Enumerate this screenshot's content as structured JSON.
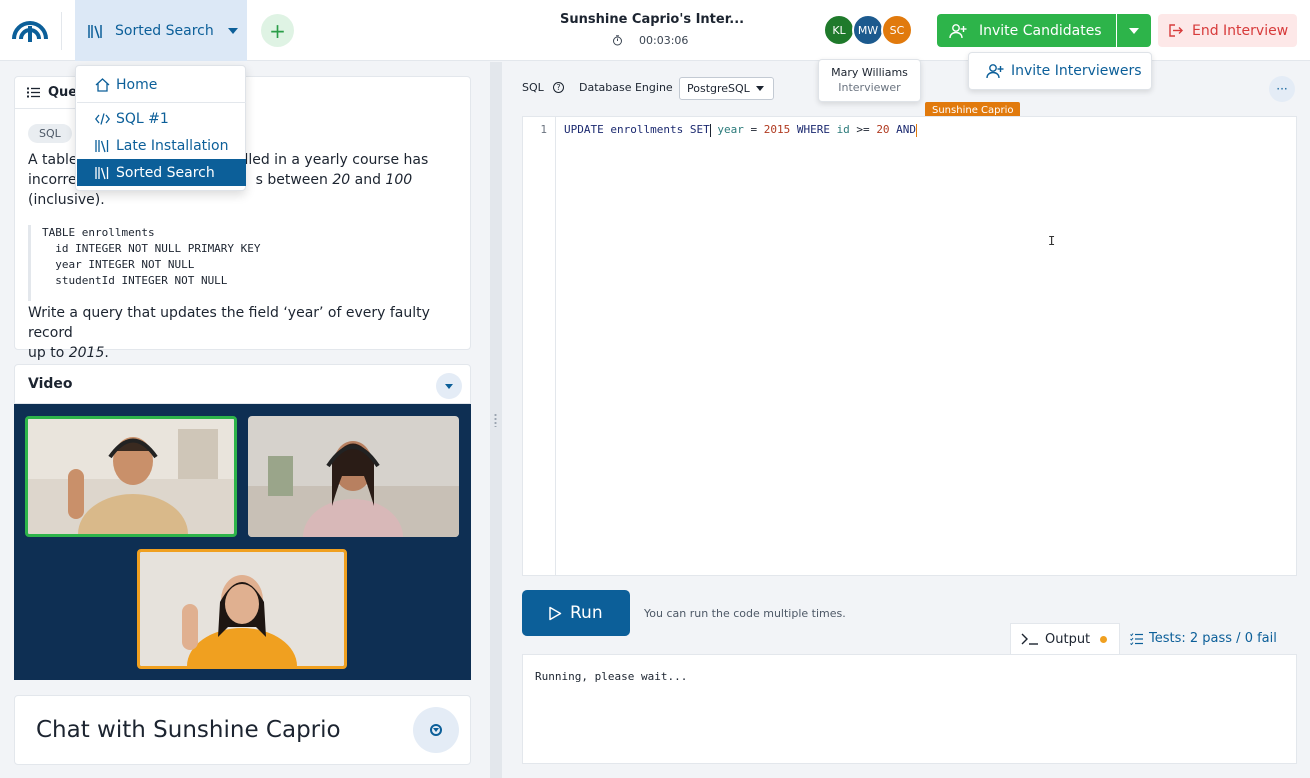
{
  "header": {
    "active_tab_label": "Sorted Search",
    "interview_title": "Sunshine Caprio's Inter...",
    "timer": "00:03:06",
    "participants": [
      {
        "initials": "KL",
        "color": "#1f7a2b"
      },
      {
        "initials": "MW",
        "color": "#1c5a8e"
      },
      {
        "initials": "SC",
        "color": "#e17a0d"
      }
    ],
    "invite_candidates_label": "Invite Candidates",
    "end_interview_label": "End Interview",
    "invite_interviewers_label": "Invite Interviewers",
    "tooltip": {
      "name": "Mary Williams",
      "role": "Interviewer"
    }
  },
  "tab_menu": {
    "items": [
      {
        "label": "Home",
        "icon": "home-icon"
      },
      {
        "label": "SQL #1",
        "icon": "code-icon"
      },
      {
        "label": "Late Installation",
        "icon": "library-icon"
      },
      {
        "label": "Sorted Search",
        "icon": "library-icon",
        "selected": true
      }
    ]
  },
  "question": {
    "tab_label": "Que",
    "tag": "SQL",
    "intro_a": "A table",
    "intro_b": "enrolled in a yearly course has",
    "intro_c": "incorre",
    "intro_d": "s between ",
    "range_low": "20",
    "range_and": " and ",
    "range_high": "100",
    "intro_e": "(inclusive).",
    "schema": [
      "TABLE enrollments",
      "  id INTEGER NOT NULL PRIMARY KEY",
      "  year INTEGER NOT NULL",
      "  studentId INTEGER NOT NULL"
    ],
    "task_a": "Write a query that updates the field ‘year’ of every faulty record",
    "task_b": "up to ",
    "task_year": "2015",
    "task_c": "."
  },
  "video": {
    "title": "Video"
  },
  "chat": {
    "title": "Chat with Sunshine Caprio"
  },
  "editor": {
    "language_label": "SQL",
    "help_glyph": "?",
    "engine_label": "Database Engine",
    "engine_value": "PostgreSQL",
    "more_glyph": "···",
    "remote_cursor_name": "Sunshine Caprio",
    "line_number": "1",
    "code_tokens": {
      "t1": "UPDATE enrollments SET",
      "t2": " year",
      "t3": " = ",
      "t4": "2015",
      "t5": " WHERE ",
      "t6": "id",
      "t7": " >= ",
      "t8": "20",
      "t9": " AND"
    },
    "ibeam": "I"
  },
  "run": {
    "label": "Run",
    "hint": "You can run the code multiple times."
  },
  "output": {
    "tab_label": "Output",
    "tests_label": "Tests: 2 pass / 0 fail",
    "text": "Running, please wait..."
  },
  "colors": {
    "brand_blue": "#0c5f99",
    "green": "#2db44a",
    "danger": "#d73a3a",
    "orange": "#e17a0d"
  }
}
